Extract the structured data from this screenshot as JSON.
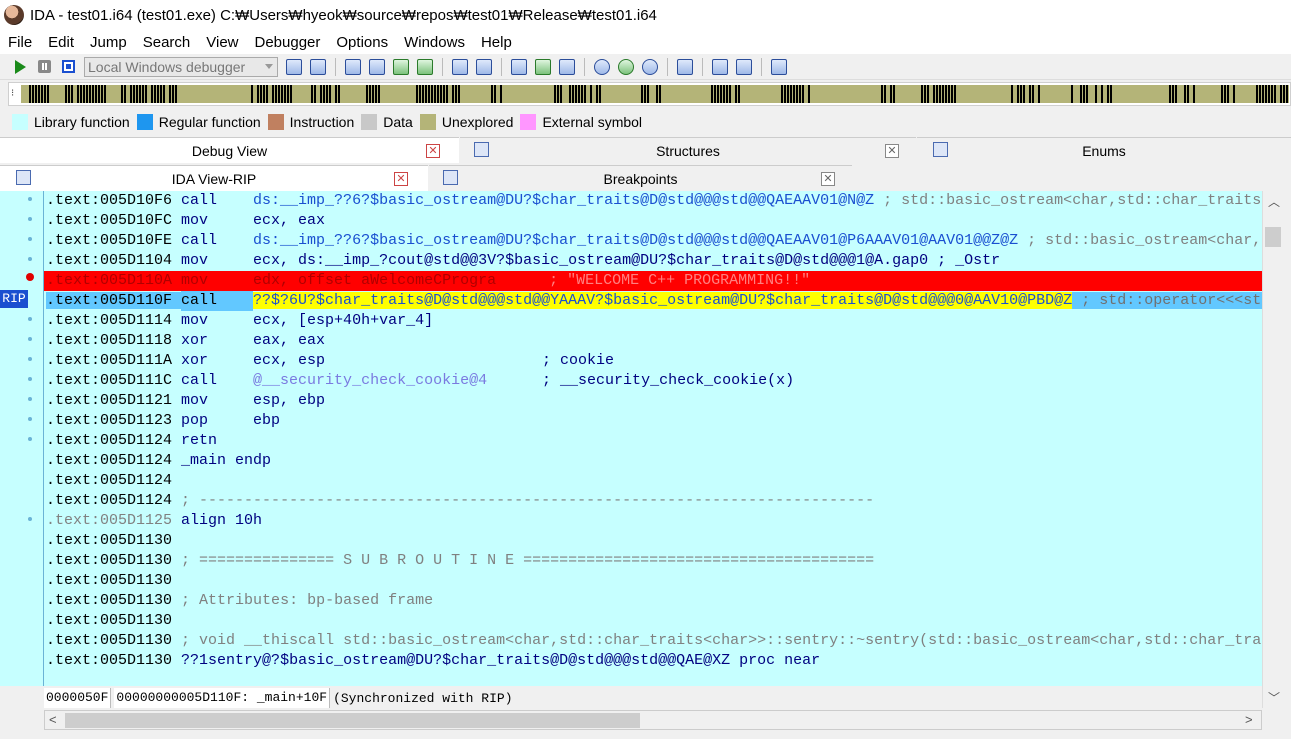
{
  "window": {
    "title": "IDA - test01.i64 (test01.exe) C:₩Users₩hyeok₩source₩repos₩test01₩Release₩test01.i64"
  },
  "menu": [
    "File",
    "Edit",
    "Jump",
    "Search",
    "View",
    "Debugger",
    "Options",
    "Windows",
    "Help"
  ],
  "toolbar": {
    "debugger_select": "Local Windows debugger"
  },
  "legend": [
    {
      "label": "Library function",
      "color": "#c6ffff"
    },
    {
      "label": "Regular function",
      "color": "#1e96ef"
    },
    {
      "label": "Instruction",
      "color": "#c08060"
    },
    {
      "label": "Data",
      "color": "#c8c8c8"
    },
    {
      "label": "Unexplored",
      "color": "#b4b478"
    },
    {
      "label": "External symbol",
      "color": "#ff96ff"
    }
  ],
  "tabs_top": [
    {
      "label": "Debug View"
    },
    {
      "label": "Structures"
    },
    {
      "label": "Enums"
    }
  ],
  "tabs_second": [
    {
      "label": "IDA View-RIP"
    },
    {
      "label": "Breakpoints"
    }
  ],
  "code": {
    "rip_label": "RIP",
    "lines": [
      {
        "addr": ".text:005D10F6",
        "mn": "call",
        "op": "ds:__imp_??6?$basic_ostream@DU?$char_traits@D@std@@@std@@QAEAAV01@N@Z",
        "cmt": " ; std::basic_ostream<char,std::char_traits<char>>::operator<<(double)"
      },
      {
        "addr": ".text:005D10FC",
        "mn": "mov",
        "op": "ecx, eax",
        "cmt": ""
      },
      {
        "addr": ".text:005D10FE",
        "mn": "call",
        "op": "ds:__imp_??6?$basic_ostream@DU?$char_traits@D@std@@@std@@QAEAAV01@P6AAAV01@AAV01@@Z@Z",
        "cmt": " ; std::basic_ostream<char,std::char_traits<char>>::operator<<"
      },
      {
        "addr": ".text:005D1104",
        "mn": "mov",
        "op": "ecx, ds:__imp_?cout@std@@3V?$basic_ostream@DU?$char_traits@D@std@@@1@A.gap0",
        "cmt": " ; _Ostr"
      },
      {
        "addr": ".text:005D110A",
        "mn": "mov",
        "op": "edx, offset aWelcomeCProgra",
        "cmt": " ; \"WELCOME C++ PROGRAMMING!!\""
      },
      {
        "addr": ".text:005D110F",
        "mn": "call",
        "op": "??$?6U?$char_traits@D@std@@@std@@YAAAV?$basic_ostream@DU?$char_traits@D@std@@@0@AAV10@PBD@Z",
        "cmt": " ; std::operator<<<std::char_traits<char>>(std::basic_ostream<char>&,char const*)"
      },
      {
        "addr": ".text:005D1114",
        "mn": "mov",
        "op": "ecx, [esp+40h+var_4]",
        "cmt": ""
      },
      {
        "addr": ".text:005D1118",
        "mn": "xor",
        "op": "eax, eax",
        "cmt": ""
      },
      {
        "addr": ".text:005D111A",
        "mn": "xor",
        "op": "ecx, esp",
        "cmt": "; cookie"
      },
      {
        "addr": ".text:005D111C",
        "mn": "call",
        "op": "@__security_check_cookie@4",
        "cmt": "; __security_check_cookie(x)"
      },
      {
        "addr": ".text:005D1121",
        "mn": "mov",
        "op": "esp, ebp",
        "cmt": ""
      },
      {
        "addr": ".text:005D1123",
        "mn": "pop",
        "op": "ebp",
        "cmt": ""
      },
      {
        "addr": ".text:005D1124",
        "mn": "retn",
        "op": "",
        "cmt": ""
      },
      {
        "addr": ".text:005D1124",
        "text": "_main endp"
      },
      {
        "addr": ".text:005D1124",
        "text": ""
      },
      {
        "addr": ".text:005D1124",
        "text": "; ---------------------------------------------------------------------------"
      },
      {
        "addr": ".text:005D1125",
        "text": "align 10h"
      },
      {
        "addr": ".text:005D1130",
        "text": ""
      },
      {
        "addr": ".text:005D1130",
        "text": "; =============== S U B R O U T I N E ======================================="
      },
      {
        "addr": ".text:005D1130",
        "text": ""
      },
      {
        "addr": ".text:005D1130",
        "text": "; Attributes: bp-based frame"
      },
      {
        "addr": ".text:005D1130",
        "text": ""
      },
      {
        "addr": ".text:005D1130",
        "text": "; void __thiscall std::basic_ostream<char,std::char_traits<char>>::sentry::~sentry(std::basic_ostream<char,std::char_traits<char>>::sentry *__hidden this)"
      },
      {
        "addr": ".text:005D1130",
        "text": "??1sentry@?$basic_ostream@DU?$char_traits@D@std@@@std@@QAE@XZ proc near"
      }
    ]
  },
  "status": {
    "offset": "0000050F",
    "location": "00000000005D110F: _main+10F",
    "sync": "(Synchronized with RIP)"
  }
}
